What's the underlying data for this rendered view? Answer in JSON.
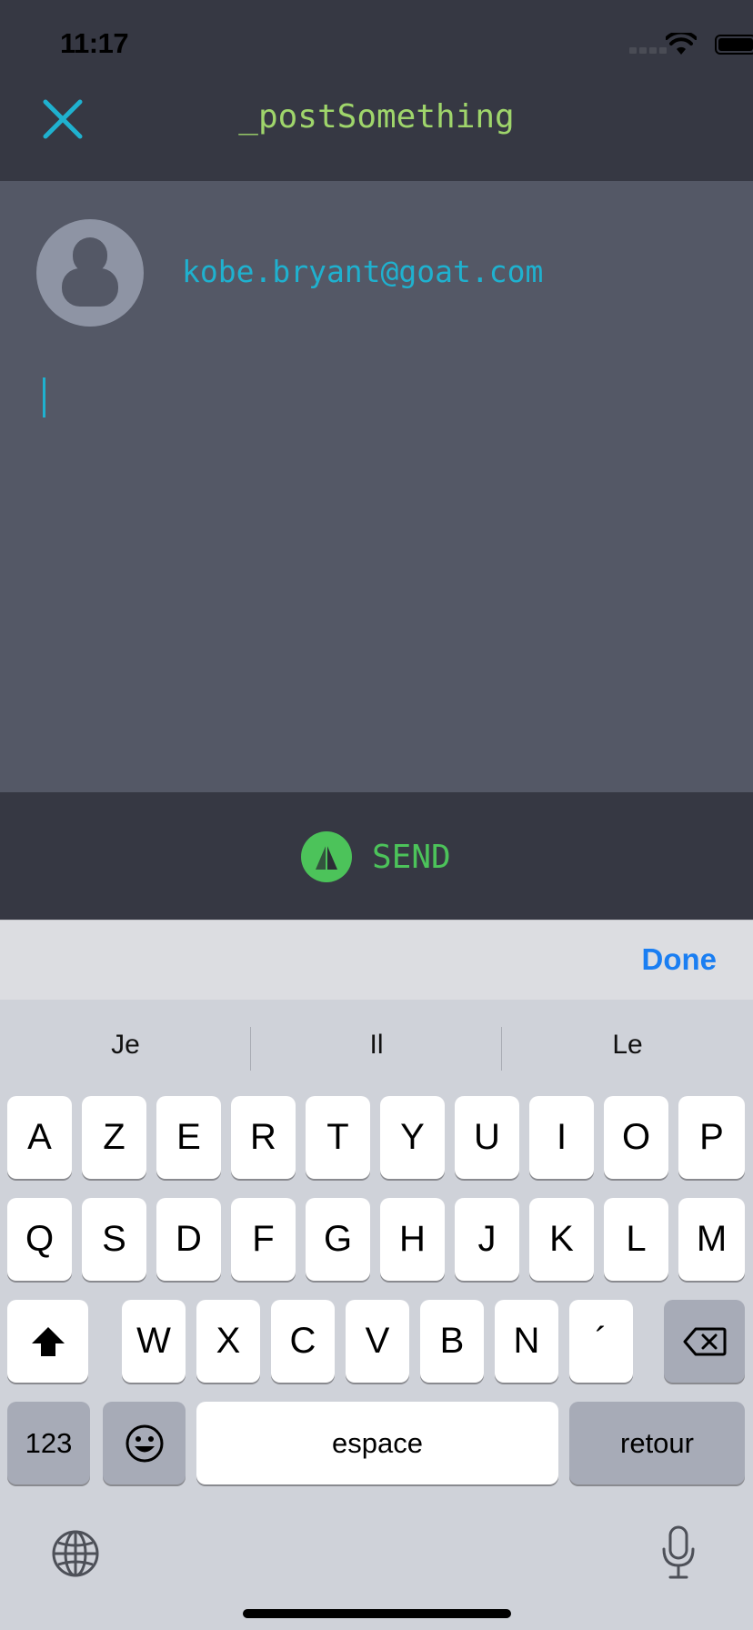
{
  "status_bar": {
    "time": "11:17"
  },
  "header": {
    "title": "_postSomething"
  },
  "compose": {
    "user_email": "kobe.bryant@goat.com",
    "text_value": ""
  },
  "send": {
    "label": "SEND"
  },
  "keyboard": {
    "done_label": "Done",
    "suggestions": [
      "Je",
      "Il",
      "Le"
    ],
    "row1": [
      "A",
      "Z",
      "E",
      "R",
      "T",
      "Y",
      "U",
      "I",
      "O",
      "P"
    ],
    "row2": [
      "Q",
      "S",
      "D",
      "F",
      "G",
      "H",
      "J",
      "K",
      "L",
      "M"
    ],
    "row3": [
      "W",
      "X",
      "C",
      "V",
      "B",
      "N",
      "´"
    ],
    "numbers_label": "123",
    "space_label": "espace",
    "return_label": "retour"
  },
  "colors": {
    "accent_cyan": "#1fb1cf",
    "title_green": "#9fd56b",
    "send_green": "#4cc35a",
    "done_blue": "#1a7ef2"
  },
  "icons": [
    "close-icon",
    "avatar-icon",
    "send-icon",
    "shift-icon",
    "backspace-icon",
    "emoji-icon",
    "globe-icon",
    "mic-icon",
    "wifi-icon",
    "battery-icon"
  ]
}
